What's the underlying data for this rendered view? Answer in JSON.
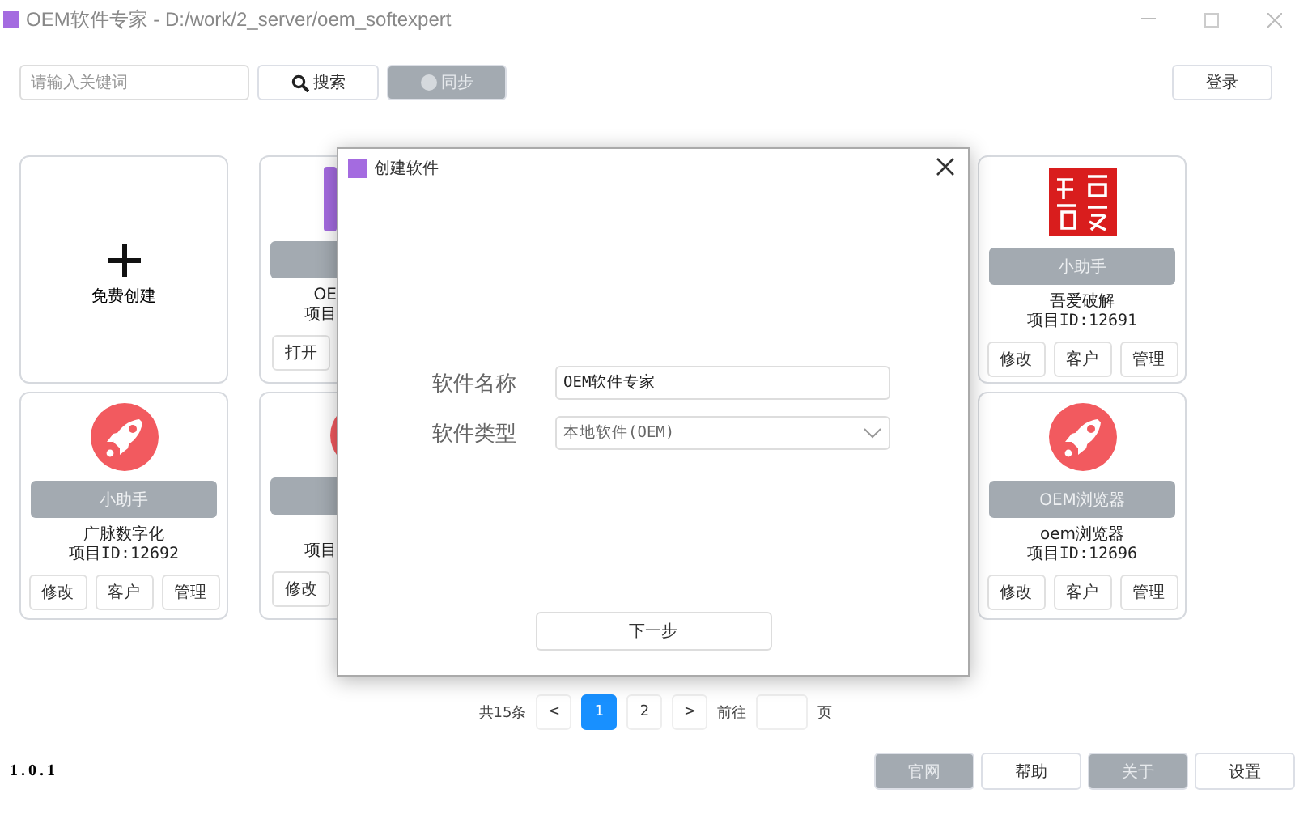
{
  "window": {
    "title": "OEM软件专家 - D:/work/2_server/oem_softexpert"
  },
  "toolbar": {
    "search": {
      "placeholder": "请输入关键词"
    },
    "search_button": "搜索",
    "sync_button": {
      "label": "同步",
      "disabled": true
    },
    "login_button": "登录"
  },
  "cards": [
    {
      "kind": "create",
      "label": "免费创建"
    },
    {
      "kind": "clipped-app",
      "name": "OE",
      "id": "项目",
      "buttons": [
        "打开"
      ]
    },
    {
      "kind": "gap"
    },
    {
      "kind": "gap"
    },
    {
      "kind": "stamp",
      "tag": "小助手",
      "name": "吾爱破解",
      "id": "项目ID:12691",
      "buttons": [
        "修改",
        "客户",
        "管理"
      ]
    },
    {
      "kind": "rocket",
      "tag": "小助手",
      "name": "广脉数字化",
      "id": "项目ID:12692",
      "buttons": [
        "修改",
        "客户",
        "管理"
      ]
    },
    {
      "kind": "clipped-rocket",
      "id": "项目",
      "buttons": [
        "修改"
      ]
    },
    {
      "kind": "gap"
    },
    {
      "kind": "gap"
    },
    {
      "kind": "rocket",
      "tag": "OEM浏览器",
      "name": "oem浏览器",
      "id": "项目ID:12696",
      "buttons": [
        "修改",
        "客户",
        "管理"
      ]
    }
  ],
  "pagination": {
    "total": "共15条",
    "prev": "<",
    "pages": [
      {
        "label": "1",
        "selected": true
      },
      {
        "label": "2",
        "selected": false
      }
    ],
    "next": ">",
    "goto": "前往",
    "unit": "页"
  },
  "footer": {
    "version": "1.0.1",
    "buttons": [
      {
        "label": "官网",
        "disabled": true
      },
      {
        "label": "帮助",
        "disabled": false
      },
      {
        "label": "关于",
        "disabled": true
      },
      {
        "label": "设置",
        "disabled": false
      }
    ]
  },
  "dialog": {
    "title": "创建软件",
    "fields": [
      {
        "label": "软件名称",
        "kind": "input",
        "value": "OEM软件专家"
      },
      {
        "label": "软件类型",
        "kind": "select",
        "value": "本地软件(OEM)"
      }
    ],
    "next_button": "下一步"
  }
}
